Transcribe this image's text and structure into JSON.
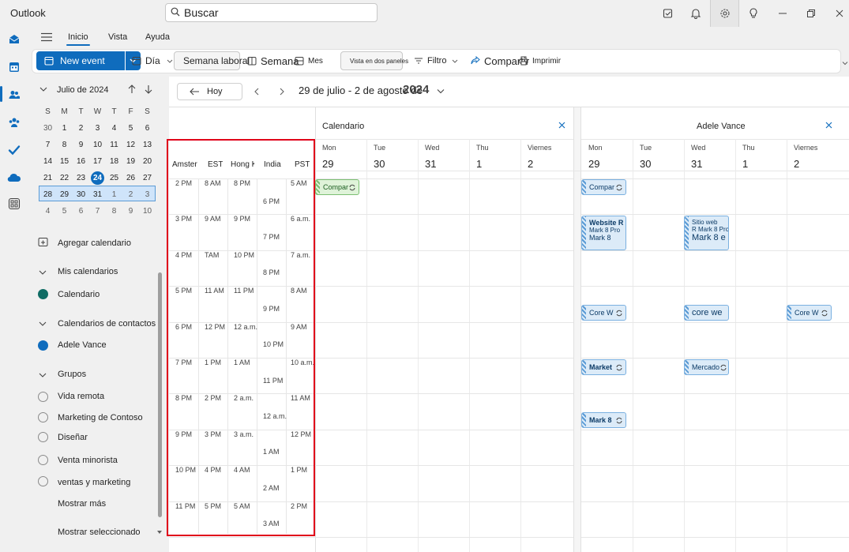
{
  "app": {
    "title": "Outlook"
  },
  "search": {
    "value": "Buscar"
  },
  "ribbon": {
    "tabs": [
      "Inicio",
      "Vista",
      "Ayuda"
    ],
    "new_event": "New event",
    "dia": "Día",
    "semana_laboral": "Semana laboral",
    "semana": "Semana",
    "mes": "Mes",
    "vista_dos_paneles": "Vista en dos paneles",
    "filtro": "Filtro",
    "compartir": "Compartir",
    "imprimir": "Imprimir"
  },
  "mini_calendar": {
    "month_label": "Julio de 2024",
    "weekday_headers": [
      "S",
      "M",
      "T",
      "W",
      "T",
      "F",
      "S"
    ],
    "weeks": [
      [
        "30",
        "1",
        "2",
        "3",
        "4",
        "5",
        "6"
      ],
      [
        "7",
        "8",
        "9",
        "10",
        "11",
        "12",
        "13"
      ],
      [
        "14",
        "15",
        "16",
        "17",
        "18",
        "19",
        "20"
      ],
      [
        "21",
        "22",
        "23",
        "24",
        "25",
        "26",
        "27"
      ],
      [
        "28",
        "29",
        "30",
        "31",
        "1",
        "2",
        "3"
      ],
      [
        "4",
        "5",
        "6",
        "7",
        "8",
        "9",
        "10"
      ]
    ],
    "today": "24"
  },
  "left_panel": {
    "add_calendar": "Agregar calendario",
    "my_calendars": "Mis calendarios",
    "calendario": "Calendario",
    "contact_calendars": "Calendarios de contactos",
    "adele": "Adele Vance",
    "groups": "Grupos",
    "group_items": [
      "Vida remota",
      "Marketing de Contoso",
      "Diseñar",
      "Venta minorista",
      "ventas y marketing"
    ],
    "show_more": "Mostrar más",
    "show_selected": "Mostrar seleccionado"
  },
  "toolbar": {
    "today": "Hoy",
    "date_range": "29 de julio - 2 de agosto de",
    "year": "2024"
  },
  "panes": {
    "left_title": "Calendario",
    "right_title": "Adele Vance"
  },
  "timezones": {
    "headers": [
      "Amsterdam",
      "EST",
      "Hong K",
      "India",
      "PST"
    ],
    "amsterdam": [
      "2 PM",
      "3 PM",
      "4 PM",
      "5 PM",
      "6 PM",
      "7 PM",
      "8 PM",
      "9 PM",
      "10 PM",
      "11 PM"
    ],
    "est": [
      "8 AM",
      "9 AM",
      "TAM",
      "11 AM",
      "12 PM",
      "1 PM",
      "2 PM",
      "3 PM",
      "4 PM",
      "5 PM"
    ],
    "hongkong": [
      "8 PM",
      "9 PM",
      "10 PM",
      "11 PM",
      "12 a.m.",
      "1 AM",
      "2 a.m.",
      "3 a.m.",
      "4 AM",
      "5 AM"
    ],
    "india": [
      "6 PM",
      "7 PM",
      "8 PM",
      "9 PM",
      "10 PM",
      "11 PM",
      "12 a.m.",
      "1 AM",
      "2 AM",
      "3 AM"
    ],
    "pst": [
      "5 AM",
      "6 a.m.",
      "7 a.m.",
      "8 AM",
      "9 AM",
      "10 a.m.",
      "11 AM",
      "12 PM",
      "1 PM",
      "2 PM"
    ]
  },
  "days": [
    {
      "name": "Mon",
      "num": "29"
    },
    {
      "name": "Tue",
      "num": "30"
    },
    {
      "name": "Wed",
      "num": "31"
    },
    {
      "name": "Thu",
      "num": "1"
    },
    {
      "name": "Viernes",
      "num": "2"
    }
  ],
  "events": {
    "left_compar": "Compar",
    "r_compar": "Compar",
    "r_website_1": "Website R",
    "r_website_2": "Mark 8 Pro",
    "r_website_3": "Mark 8",
    "r_sitio_1": "Sitio web",
    "r_sitio_2": "R Mark 8 Pro",
    "r_sitio_3": "Mark 8 e",
    "r_core_mon": "Core W",
    "r_core_wed": "core we",
    "r_core_fri": "Core W",
    "r_market": "Market",
    "r_mercado": "Mercado",
    "r_mark8": "Mark 8"
  },
  "colors": {
    "accent": "#0f6cbd",
    "highlight_box": "#e0001a",
    "event_green": "#dff3d9",
    "event_blue": "#dcebf8"
  }
}
